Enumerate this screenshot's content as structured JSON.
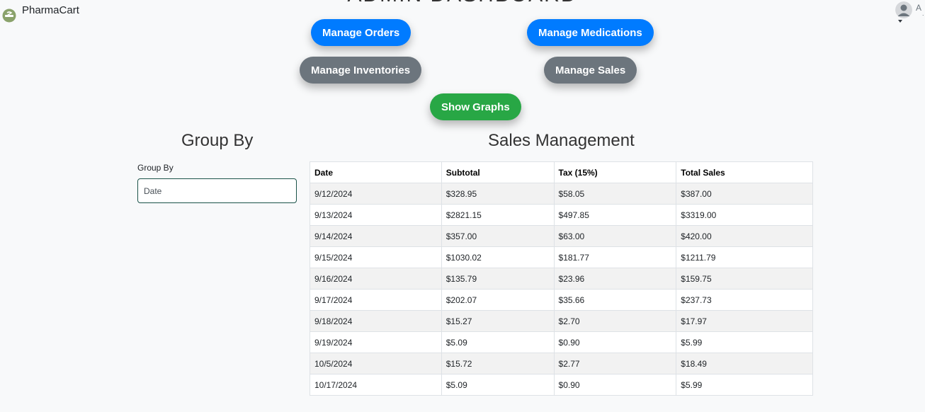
{
  "navbar": {
    "brand": "PharmaCart",
    "user_initial": "A",
    "user_sub": "."
  },
  "dashboard": {
    "title": "ADMIN DASHBOARD"
  },
  "buttons": {
    "manage_orders": "Manage Orders",
    "manage_medications": "Manage Medications",
    "manage_inventories": "Manage Inventories",
    "manage_sales": "Manage Sales",
    "show_graphs": "Show Graphs"
  },
  "group_by": {
    "heading": "Group By",
    "label": "Group By",
    "value": "Date"
  },
  "sales": {
    "heading": "Sales Management",
    "columns": [
      "Date",
      "Subtotal",
      "Tax (15%)",
      "Total Sales"
    ],
    "rows": [
      [
        "9/12/2024",
        "$328.95",
        "$58.05",
        "$387.00"
      ],
      [
        "9/13/2024",
        "$2821.15",
        "$497.85",
        "$3319.00"
      ],
      [
        "9/14/2024",
        "$357.00",
        "$63.00",
        "$420.00"
      ],
      [
        "9/15/2024",
        "$1030.02",
        "$181.77",
        "$1211.79"
      ],
      [
        "9/16/2024",
        "$135.79",
        "$23.96",
        "$159.75"
      ],
      [
        "9/17/2024",
        "$202.07",
        "$35.66",
        "$237.73"
      ],
      [
        "9/18/2024",
        "$15.27",
        "$2.70",
        "$17.97"
      ],
      [
        "9/19/2024",
        "$5.09",
        "$0.90",
        "$5.99"
      ],
      [
        "10/5/2024",
        "$15.72",
        "$2.77",
        "$18.49"
      ],
      [
        "10/17/2024",
        "$5.09",
        "$0.90",
        "$5.99"
      ]
    ]
  },
  "colors": {
    "primary": "#007bff",
    "secondary": "#6c757d",
    "success": "#28a745",
    "row_stripe": "#f2f2f2",
    "background": "#f8f9fa"
  },
  "icons": {
    "brand": "pharmacy-logo-icon",
    "user": "user-avatar-icon",
    "caret": "caret-down-icon"
  }
}
